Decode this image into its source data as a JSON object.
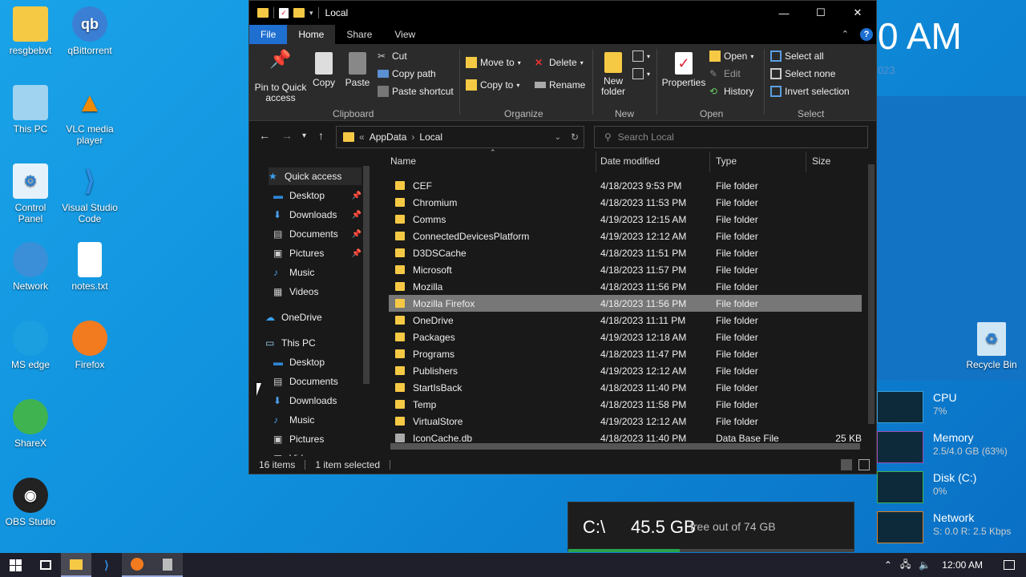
{
  "desktop": {
    "icons_left": [
      {
        "label": "resgbebvt",
        "name": "user-folder"
      },
      {
        "label": "qBittorrent",
        "name": "qbittorrent"
      },
      {
        "label": "This PC",
        "name": "this-pc"
      },
      {
        "label": "VLC media player",
        "name": "vlc"
      },
      {
        "label": "Control Panel",
        "name": "control-panel"
      },
      {
        "label": "Visual Studio Code",
        "name": "vscode"
      },
      {
        "label": "Network",
        "name": "network"
      },
      {
        "label": "notes.txt",
        "name": "notes"
      },
      {
        "label": "MS edge",
        "name": "edge"
      },
      {
        "label": "Firefox",
        "name": "firefox"
      },
      {
        "label": "ShareX",
        "name": "sharex"
      },
      {
        "label": "OBS Studio",
        "name": "obs"
      }
    ],
    "recycle_bin": "Recycle Bin",
    "clock_fragment": "0 AM",
    "year_fragment": "023"
  },
  "window": {
    "title": "Local",
    "tabs": [
      "File",
      "Home",
      "Share",
      "View"
    ],
    "ribbon": {
      "clipboard": {
        "pin": "Pin to Quick access",
        "copy": "Copy",
        "paste": "Paste",
        "cut": "Cut",
        "copy_path": "Copy path",
        "paste_shortcut": "Paste shortcut",
        "label": "Clipboard"
      },
      "organize": {
        "move_to": "Move to",
        "copy_to": "Copy to",
        "delete": "Delete",
        "rename": "Rename",
        "label": "Organize"
      },
      "new": {
        "new_folder": "New folder",
        "label": "New"
      },
      "open": {
        "properties": "Properties",
        "open": "Open",
        "edit": "Edit",
        "history": "History",
        "label": "Open"
      },
      "select": {
        "select_all": "Select all",
        "select_none": "Select none",
        "invert": "Invert selection",
        "label": "Select"
      }
    },
    "address": {
      "crumbs": [
        "AppData",
        "Local"
      ],
      "prefix": "«"
    },
    "search_placeholder": "Search Local",
    "nav": [
      {
        "label": "Quick access",
        "pinned": false
      },
      {
        "label": "Desktop",
        "pinned": true
      },
      {
        "label": "Downloads",
        "pinned": true
      },
      {
        "label": "Documents",
        "pinned": true
      },
      {
        "label": "Pictures",
        "pinned": true
      },
      {
        "label": "Music",
        "pinned": false
      },
      {
        "label": "Videos",
        "pinned": false
      },
      {
        "label": "OneDrive",
        "pinned": false
      },
      {
        "label": "This PC",
        "pinned": false
      },
      {
        "label": "Desktop",
        "pinned": false
      },
      {
        "label": "Documents",
        "pinned": false
      },
      {
        "label": "Downloads",
        "pinned": false
      },
      {
        "label": "Music",
        "pinned": false
      },
      {
        "label": "Pictures",
        "pinned": false
      },
      {
        "label": "Videos",
        "pinned": false
      }
    ],
    "columns": [
      "Name",
      "Date modified",
      "Type",
      "Size"
    ],
    "files": [
      {
        "name": "CEF",
        "date": "4/18/2023 9:53 PM",
        "type": "File folder",
        "size": ""
      },
      {
        "name": "Chromium",
        "date": "4/18/2023 11:53 PM",
        "type": "File folder",
        "size": ""
      },
      {
        "name": "Comms",
        "date": "4/19/2023 12:15 AM",
        "type": "File folder",
        "size": ""
      },
      {
        "name": "ConnectedDevicesPlatform",
        "date": "4/19/2023 12:12 AM",
        "type": "File folder",
        "size": ""
      },
      {
        "name": "D3DSCache",
        "date": "4/18/2023 11:51 PM",
        "type": "File folder",
        "size": ""
      },
      {
        "name": "Microsoft",
        "date": "4/18/2023 11:57 PM",
        "type": "File folder",
        "size": ""
      },
      {
        "name": "Mozilla",
        "date": "4/18/2023 11:56 PM",
        "type": "File folder",
        "size": ""
      },
      {
        "name": "Mozilla Firefox",
        "date": "4/18/2023 11:56 PM",
        "type": "File folder",
        "size": "",
        "selected": true
      },
      {
        "name": "OneDrive",
        "date": "4/18/2023 11:11 PM",
        "type": "File folder",
        "size": ""
      },
      {
        "name": "Packages",
        "date": "4/19/2023 12:18 AM",
        "type": "File folder",
        "size": ""
      },
      {
        "name": "Programs",
        "date": "4/18/2023 11:47 PM",
        "type": "File folder",
        "size": ""
      },
      {
        "name": "Publishers",
        "date": "4/19/2023 12:12 AM",
        "type": "File folder",
        "size": ""
      },
      {
        "name": "StartIsBack",
        "date": "4/18/2023 11:40 PM",
        "type": "File folder",
        "size": ""
      },
      {
        "name": "Temp",
        "date": "4/18/2023 11:58 PM",
        "type": "File folder",
        "size": ""
      },
      {
        "name": "VirtualStore",
        "date": "4/19/2023 12:12 AM",
        "type": "File folder",
        "size": ""
      },
      {
        "name": "IconCache.db",
        "date": "4/18/2023 11:40 PM",
        "type": "Data Base File",
        "size": "25 KB"
      }
    ],
    "status": {
      "items": "16 items",
      "selected": "1 item selected"
    }
  },
  "disk_widget": {
    "drive": "C:\\",
    "free": "45.5 GB",
    "text": "free out of 74 GB",
    "used_fraction": 0.39
  },
  "perf": [
    {
      "title": "CPU",
      "value": "7%"
    },
    {
      "title": "Memory",
      "value": "2.5/4.0 GB (63%)"
    },
    {
      "title": "Disk (C:)",
      "value": "0%"
    },
    {
      "title": "Network",
      "value": "S: 0.0 R: 2.5 Kbps"
    }
  ],
  "taskbar": {
    "time": "12:00 AM"
  },
  "colors": {
    "accent": "#1e6fd0",
    "folder": "#f6c945",
    "selection": "#777777"
  }
}
